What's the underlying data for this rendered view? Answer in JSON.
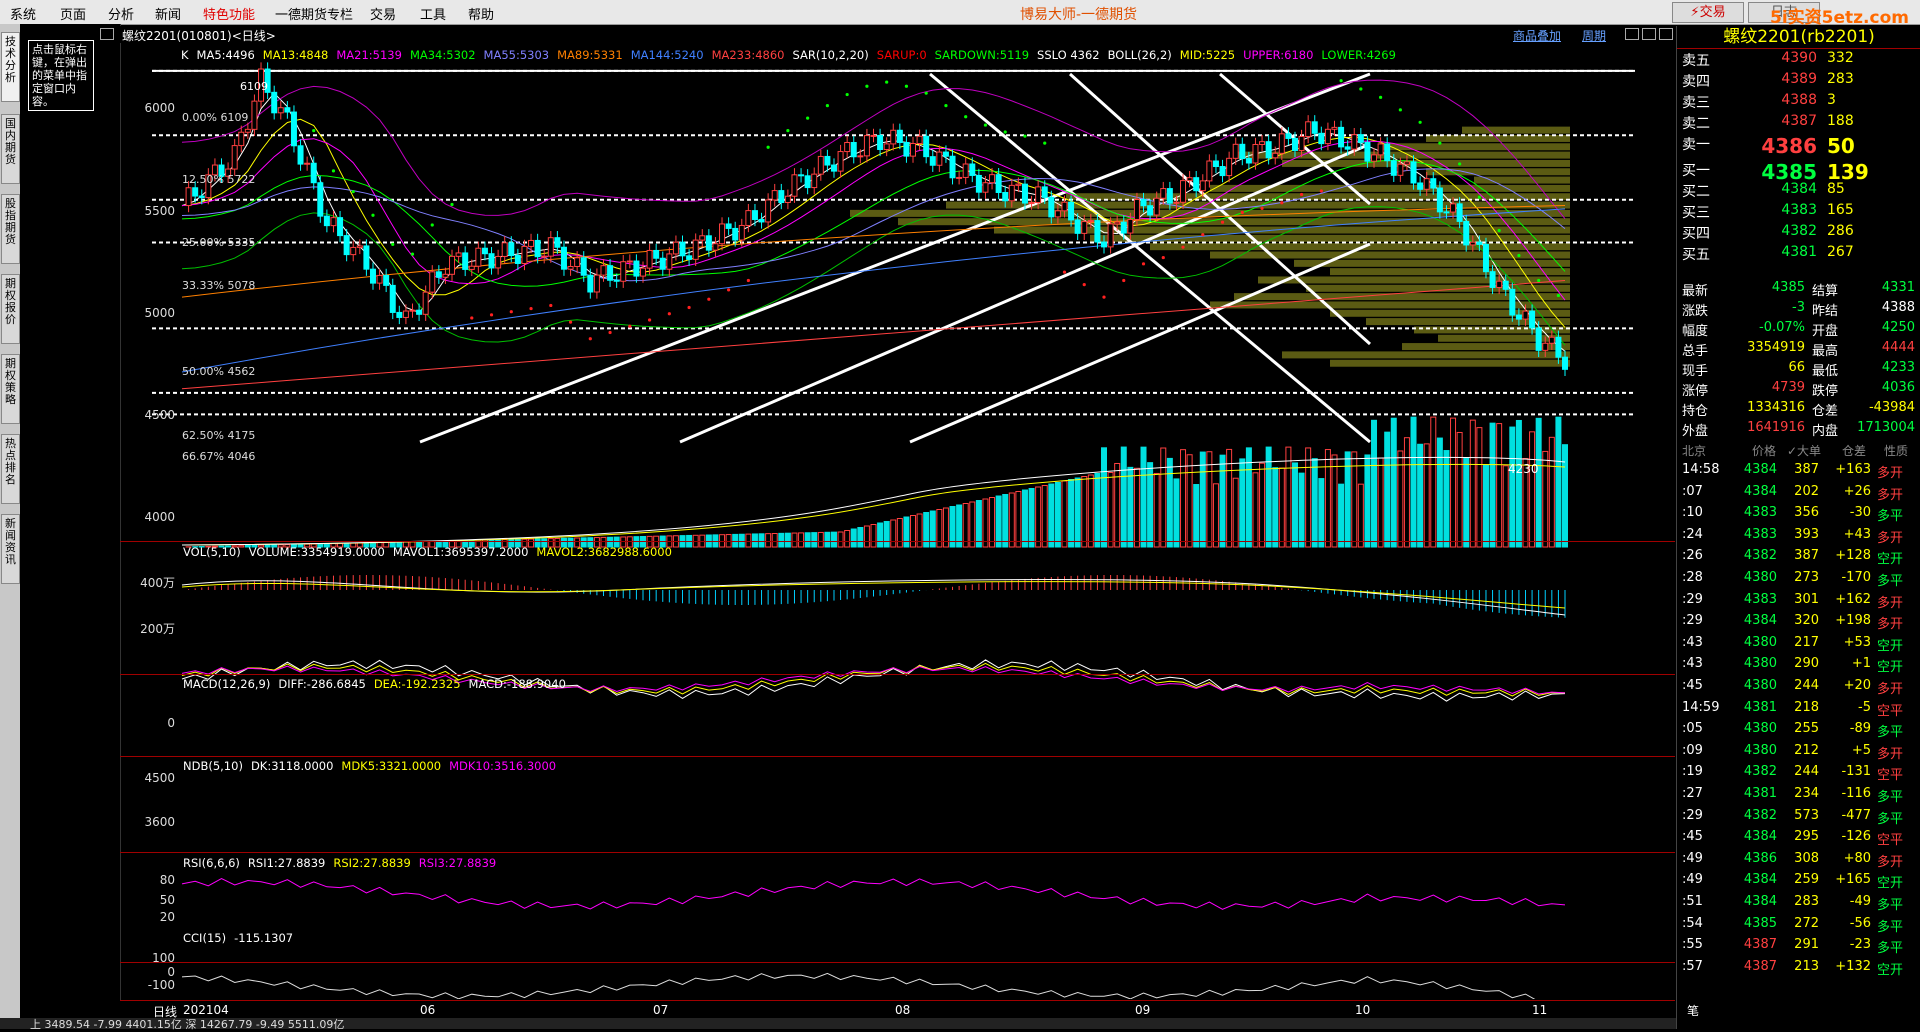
{
  "menu": {
    "items": [
      "系统",
      "页面",
      "分析",
      "新闻",
      "特色功能",
      "一德期货专栏",
      "交易",
      "工具",
      "帮助"
    ],
    "highlight_index": 4,
    "app_title": "博易大师-一德期货",
    "trade_button": "交易",
    "sell_button": "日志",
    "watermark": "5i实资5etz.com"
  },
  "left_tabs": [
    "技术分析",
    "国内期货",
    "股指期货",
    "期权报价",
    "期权策略",
    "热点排名",
    "新闻资讯"
  ],
  "tip_text": "点击鼠标右键，在弹出的菜单中指定窗口内容。",
  "chart_header": {
    "symbol": "螺纹2201(010801)<日线>",
    "overlay_link": "商品叠加",
    "period_link": "周期"
  },
  "main_legend": [
    {
      "text": "K",
      "color": "#ffffff"
    },
    {
      "text": "MA5:4496",
      "color": "#ffffff"
    },
    {
      "text": "MA13:4848",
      "color": "#ffff00"
    },
    {
      "text": "MA21:5139",
      "color": "#ff00ff"
    },
    {
      "text": "MA34:5302",
      "color": "#00ff00"
    },
    {
      "text": "MA55:5303",
      "color": "#8080ff"
    },
    {
      "text": "MA89:5331",
      "color": "#ff8000"
    },
    {
      "text": "MA144:5240",
      "color": "#4080ff"
    },
    {
      "text": "MA233:4860",
      "color": "#ff4040"
    },
    {
      "text": "SAR(10,2,20)",
      "color": "#ffffff"
    },
    {
      "text": "SARUP:0",
      "color": "#ff0000"
    },
    {
      "text": "SARDOWN:5119",
      "color": "#00ff00"
    },
    {
      "text": "SSLO 4362",
      "color": "#ffffff"
    },
    {
      "text": "BOLL(26,2)",
      "color": "#ffffff"
    },
    {
      "text": "MID:5225",
      "color": "#ffff00"
    },
    {
      "text": "UPPER:6180",
      "color": "#ff00ff"
    },
    {
      "text": "LOWER:4269",
      "color": "#00ff00"
    }
  ],
  "price_axis": [
    "6000",
    "5500",
    "5000",
    "4500",
    "4000"
  ],
  "fib_levels": [
    {
      "label": "0.00%",
      "value": "6109"
    },
    {
      "label": "12.50%",
      "value": "5722"
    },
    {
      "label": "25.00%",
      "value": "5335"
    },
    {
      "label": "33.33%",
      "value": "5078"
    },
    {
      "label": "50.00%",
      "value": "4562"
    },
    {
      "label": "62.50%",
      "value": "4175"
    },
    {
      "label": "66.67%",
      "value": "4046"
    }
  ],
  "low_marker": "4230",
  "high_marker": "6109",
  "vol_legend": [
    {
      "text": "VOL(5,10)",
      "color": "#ffffff"
    },
    {
      "text": "VOLUME:3354919.0000",
      "color": "#ffffff"
    },
    {
      "text": "MAVOL1:3695397.2000",
      "color": "#ffffff"
    },
    {
      "text": "MAVOL2:3682988.6000",
      "color": "#ffff00"
    }
  ],
  "vol_axis": [
    "400万",
    "200万"
  ],
  "macd_legend": [
    {
      "text": "MACD(12,26,9)",
      "color": "#ffffff"
    },
    {
      "text": "DIFF:-286.6845",
      "color": "#ffffff"
    },
    {
      "text": "DEA:-192.2325",
      "color": "#ffff00"
    },
    {
      "text": "MACD:-188.9040",
      "color": "#ffffff"
    }
  ],
  "macd_axis": [
    "0"
  ],
  "ndb_legend": [
    {
      "text": "NDB(5,10)",
      "color": "#ffffff"
    },
    {
      "text": "DK:3118.0000",
      "color": "#ffffff"
    },
    {
      "text": "MDK5:3321.0000",
      "color": "#ffff00"
    },
    {
      "text": "MDK10:3516.3000",
      "color": "#ff00ff"
    }
  ],
  "ndb_axis": [
    "4500",
    "3600"
  ],
  "rsi_legend": [
    {
      "text": "RSI(6,6,6)",
      "color": "#ffffff"
    },
    {
      "text": "RSI1:27.8839",
      "color": "#ffffff"
    },
    {
      "text": "RSI2:27.8839",
      "color": "#ffff00"
    },
    {
      "text": "RSI3:27.8839",
      "color": "#ff00ff"
    }
  ],
  "rsi_axis": [
    "80",
    "50",
    "20"
  ],
  "cci_legend": [
    {
      "text": "CCI(15)",
      "color": "#ffffff"
    },
    {
      "text": "-115.1307",
      "color": "#ffffff"
    }
  ],
  "cci_axis": [
    "100",
    "0",
    "-100"
  ],
  "date_axis": {
    "label": "日线",
    "ticks": [
      "202104",
      "06",
      "07",
      "08",
      "09",
      "10",
      "11"
    ]
  },
  "quote": {
    "title": "螺纹2201(rb2201)",
    "asks": [
      {
        "label": "卖五",
        "price": "4390",
        "vol": "332"
      },
      {
        "label": "卖四",
        "price": "4389",
        "vol": "283"
      },
      {
        "label": "卖三",
        "price": "4388",
        "vol": "3"
      },
      {
        "label": "卖二",
        "price": "4387",
        "vol": "188"
      },
      {
        "label": "卖一",
        "price": "4386",
        "vol": "50"
      }
    ],
    "bids": [
      {
        "label": "买一",
        "price": "4385",
        "vol": "139"
      },
      {
        "label": "买二",
        "price": "4384",
        "vol": "85"
      },
      {
        "label": "买三",
        "price": "4383",
        "vol": "165"
      },
      {
        "label": "买四",
        "price": "4382",
        "vol": "286"
      },
      {
        "label": "买五",
        "price": "4381",
        "vol": "267"
      }
    ],
    "stats": [
      {
        "l1": "最新",
        "v1": "4385",
        "c1": "green",
        "l2": "结算",
        "v2": "4331",
        "c2": "green"
      },
      {
        "l1": "涨跌",
        "v1": "-3",
        "c1": "green",
        "l2": "昨结",
        "v2": "4388",
        "c2": "white"
      },
      {
        "l1": "幅度",
        "v1": "-0.07%",
        "c1": "green",
        "l2": "开盘",
        "v2": "4250",
        "c2": "green"
      },
      {
        "l1": "总手",
        "v1": "3354919",
        "c1": "yellow",
        "l2": "最高",
        "v2": "4444",
        "c2": "red"
      },
      {
        "l1": "现手",
        "v1": "66",
        "c1": "yellow",
        "l2": "最低",
        "v2": "4233",
        "c2": "green"
      },
      {
        "l1": "涨停",
        "v1": "4739",
        "c1": "red",
        "l2": "跌停",
        "v2": "4036",
        "c2": "green"
      },
      {
        "l1": "持仓",
        "v1": "1334316",
        "c1": "yellow",
        "l2": "仓差",
        "v2": "-43984",
        "c2": "yellow"
      },
      {
        "l1": "外盘",
        "v1": "1641916",
        "c1": "red",
        "l2": "内盘",
        "v2": "1713004",
        "c2": "green"
      }
    ],
    "ticks_header": {
      "loc": "北京",
      "price": "价格",
      "bigorder": "✓大单",
      "oi": "仓差",
      "nature": "性质"
    },
    "ticks": [
      {
        "t": "14:58",
        "p": "4384",
        "v": "387",
        "c": "+163",
        "k": "多开",
        "pc": "green",
        "cc": "yellow",
        "kc": "red"
      },
      {
        "t": ":07",
        "p": "4384",
        "v": "202",
        "c": "+26",
        "k": "多开",
        "pc": "green",
        "cc": "yellow",
        "kc": "red"
      },
      {
        "t": ":10",
        "p": "4383",
        "v": "356",
        "c": "-30",
        "k": "多平",
        "pc": "green",
        "cc": "yellow",
        "kc": "green"
      },
      {
        "t": ":24",
        "p": "4383",
        "v": "393",
        "c": "+43",
        "k": "多开",
        "pc": "green",
        "cc": "yellow",
        "kc": "red"
      },
      {
        "t": ":26",
        "p": "4382",
        "v": "387",
        "c": "+128",
        "k": "空开",
        "pc": "green",
        "cc": "yellow",
        "kc": "green"
      },
      {
        "t": ":28",
        "p": "4380",
        "v": "273",
        "c": "-170",
        "k": "多平",
        "pc": "green",
        "cc": "yellow",
        "kc": "green"
      },
      {
        "t": ":29",
        "p": "4383",
        "v": "301",
        "c": "+162",
        "k": "多开",
        "pc": "green",
        "cc": "yellow",
        "kc": "red"
      },
      {
        "t": ":29",
        "p": "4384",
        "v": "320",
        "c": "+198",
        "k": "多开",
        "pc": "green",
        "cc": "yellow",
        "kc": "red"
      },
      {
        "t": ":43",
        "p": "4380",
        "v": "217",
        "c": "+53",
        "k": "空开",
        "pc": "green",
        "cc": "yellow",
        "kc": "green"
      },
      {
        "t": ":43",
        "p": "4380",
        "v": "290",
        "c": "+1",
        "k": "空开",
        "pc": "green",
        "cc": "yellow",
        "kc": "green"
      },
      {
        "t": ":45",
        "p": "4380",
        "v": "244",
        "c": "+20",
        "k": "多开",
        "pc": "green",
        "cc": "yellow",
        "kc": "red"
      },
      {
        "t": "14:59",
        "p": "4381",
        "v": "218",
        "c": "-5",
        "k": "空平",
        "pc": "green",
        "cc": "yellow",
        "kc": "red"
      },
      {
        "t": ":05",
        "p": "4380",
        "v": "255",
        "c": "-89",
        "k": "多平",
        "pc": "green",
        "cc": "yellow",
        "kc": "green"
      },
      {
        "t": ":09",
        "p": "4380",
        "v": "212",
        "c": "+5",
        "k": "多开",
        "pc": "green",
        "cc": "yellow",
        "kc": "red"
      },
      {
        "t": ":19",
        "p": "4382",
        "v": "244",
        "c": "-131",
        "k": "空平",
        "pc": "green",
        "cc": "yellow",
        "kc": "red"
      },
      {
        "t": ":27",
        "p": "4381",
        "v": "234",
        "c": "-116",
        "k": "多平",
        "pc": "green",
        "cc": "yellow",
        "kc": "green"
      },
      {
        "t": ":29",
        "p": "4382",
        "v": "573",
        "c": "-477",
        "k": "多平",
        "pc": "green",
        "cc": "yellow",
        "kc": "green"
      },
      {
        "t": ":45",
        "p": "4384",
        "v": "295",
        "c": "-126",
        "k": "空平",
        "pc": "green",
        "cc": "yellow",
        "kc": "red"
      },
      {
        "t": ":49",
        "p": "4386",
        "v": "308",
        "c": "+80",
        "k": "多开",
        "pc": "green",
        "cc": "yellow",
        "kc": "red"
      },
      {
        "t": ":49",
        "p": "4384",
        "v": "259",
        "c": "+165",
        "k": "空开",
        "pc": "green",
        "cc": "yellow",
        "kc": "green"
      },
      {
        "t": ":51",
        "p": "4384",
        "v": "283",
        "c": "-49",
        "k": "多平",
        "pc": "green",
        "cc": "yellow",
        "kc": "green"
      },
      {
        "t": ":54",
        "p": "4385",
        "v": "272",
        "c": "-56",
        "k": "多平",
        "pc": "green",
        "cc": "yellow",
        "kc": "green"
      },
      {
        "t": ":55",
        "p": "4387",
        "v": "291",
        "c": "-23",
        "k": "多平",
        "pc": "red",
        "cc": "yellow",
        "kc": "green"
      },
      {
        "t": ":57",
        "p": "4387",
        "v": "213",
        "c": "+132",
        "k": "空开",
        "pc": "red",
        "cc": "yellow",
        "kc": "green"
      }
    ],
    "footer_tab": "笔"
  },
  "status": {
    "left": "上 3489.54  -7.99  4401.15亿  深 14267.79  -9.49  5511.09亿"
  }
}
